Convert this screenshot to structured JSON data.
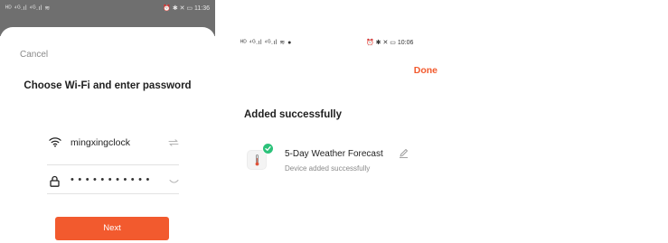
{
  "left_screen": {
    "status_left": "ᴴᴰ ⁴ᴳ.ıl ⁴ᴳ.ıl ≋",
    "status_right": "⏰ ✱ ✕ ▭ 11:36",
    "cancel": "Cancel",
    "title": "Choose Wi-Fi and enter password",
    "ssid": "mingxingclock",
    "password_mask": "•••••••••••",
    "next_button": "Next",
    "icons": [
      "wifi-icon",
      "switch-network-icon",
      "lock-icon",
      "eye-closed-icon"
    ]
  },
  "right_screen": {
    "status_left": "ᴴᴰ ⁴ᴳ.ıl ⁴ᴳ.ıl ≋ ●",
    "status_right": "⏰ ✱ ✕ ▭ 10:06",
    "done_button": "Done",
    "heading": "Added successfully",
    "device": {
      "name": "5-Day Weather Forecast",
      "status": "Device added successfully"
    },
    "icons": [
      "thermometer-icon",
      "check-icon",
      "pencil-icon"
    ]
  },
  "colors": {
    "accent": "#f25a2e",
    "success": "#2cc27a",
    "muted_text": "#8a8a8a"
  }
}
